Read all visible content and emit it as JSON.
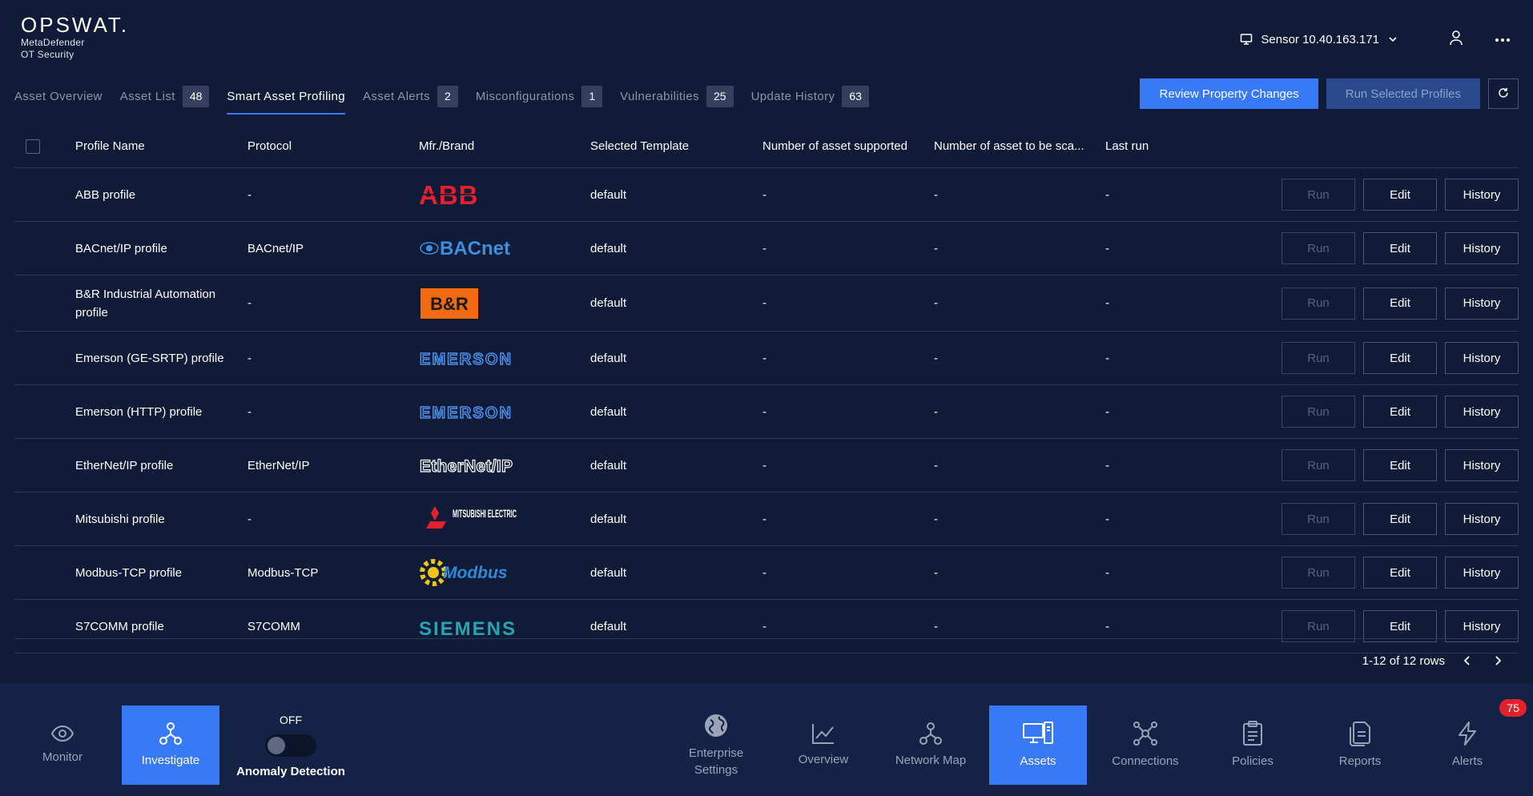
{
  "header": {
    "logo": "OPSWAT.",
    "product_line1": "MetaDefender",
    "product_line2": "OT Security",
    "sensor_label": "Sensor 10.40.163.171"
  },
  "tabs": [
    {
      "label": "Asset Overview",
      "badge": ""
    },
    {
      "label": "Asset List",
      "badge": "48"
    },
    {
      "label": "Smart Asset Profiling",
      "badge": ""
    },
    {
      "label": "Asset Alerts",
      "badge": "2"
    },
    {
      "label": "Misconfigurations",
      "badge": "1"
    },
    {
      "label": "Vulnerabilities",
      "badge": "25"
    },
    {
      "label": "Update History",
      "badge": "63"
    }
  ],
  "actions": {
    "review": "Review Property Changes",
    "run_selected": "Run Selected Profiles"
  },
  "columns": {
    "name": "Profile Name",
    "protocol": "Protocol",
    "brand": "Mfr./Brand",
    "template": "Selected Template",
    "supported": "Number of asset supported",
    "to_scan": "Number of asset to be sca...",
    "last_run": "Last run"
  },
  "row_buttons": {
    "run": "Run",
    "edit": "Edit",
    "history": "History"
  },
  "rows": [
    {
      "name": "ABB profile",
      "protocol": "-",
      "brand": "ABB",
      "template": "default",
      "supported": "-",
      "to_scan": "-",
      "last_run": "-"
    },
    {
      "name": "BACnet/IP profile",
      "protocol": "BACnet/IP",
      "brand": "BACnet",
      "template": "default",
      "supported": "-",
      "to_scan": "-",
      "last_run": "-"
    },
    {
      "name": "B&R Industrial Automation profile",
      "protocol": "-",
      "brand": "B&R",
      "template": "default",
      "supported": "-",
      "to_scan": "-",
      "last_run": "-"
    },
    {
      "name": "Emerson (GE-SRTP) profile",
      "protocol": "-",
      "brand": "EMERSON",
      "template": "default",
      "supported": "-",
      "to_scan": "-",
      "last_run": "-"
    },
    {
      "name": "Emerson (HTTP) profile",
      "protocol": "-",
      "brand": "EMERSON",
      "template": "default",
      "supported": "-",
      "to_scan": "-",
      "last_run": "-"
    },
    {
      "name": "EtherNet/IP profile",
      "protocol": "EtherNet/IP",
      "brand": "EtherNet/IP",
      "template": "default",
      "supported": "-",
      "to_scan": "-",
      "last_run": "-"
    },
    {
      "name": "Mitsubishi profile",
      "protocol": "-",
      "brand": "MITSUBISHI ELECTRIC",
      "template": "default",
      "supported": "-",
      "to_scan": "-",
      "last_run": "-"
    },
    {
      "name": "Modbus-TCP profile",
      "protocol": "Modbus-TCP",
      "brand": "Modbus",
      "template": "default",
      "supported": "-",
      "to_scan": "-",
      "last_run": "-"
    },
    {
      "name": "S7COMM profile",
      "protocol": "S7COMM",
      "brand": "SIEMENS",
      "template": "default",
      "supported": "-",
      "to_scan": "-",
      "last_run": "-"
    }
  ],
  "pagination": {
    "label": "1-12 of 12 rows"
  },
  "bottom_nav": {
    "monitor": "Monitor",
    "investigate": "Investigate",
    "anomaly_state": "OFF",
    "anomaly_label": "Anomaly Detection",
    "enterprise": "Enterprise Settings",
    "overview": "Overview",
    "network_map": "Network Map",
    "assets": "Assets",
    "connections": "Connections",
    "policies": "Policies",
    "reports": "Reports",
    "alerts": "Alerts",
    "alerts_count": "75"
  },
  "colors": {
    "accent": "#3779f6",
    "background": "#101b38",
    "alert": "#e3212d"
  }
}
